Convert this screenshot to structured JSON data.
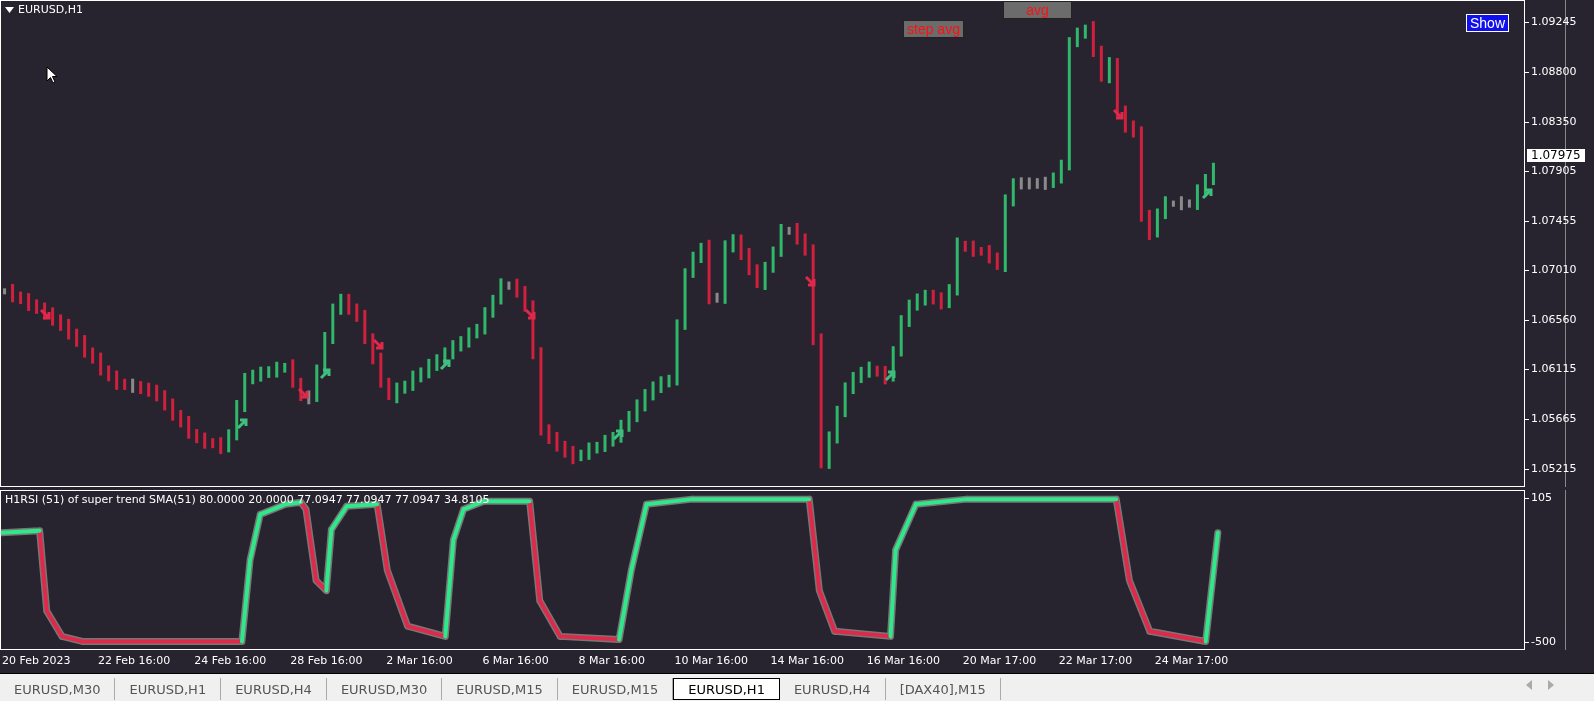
{
  "chart_title": "EURUSD,H1",
  "buttons": [
    {
      "label": "step avg",
      "kind": "step"
    },
    {
      "label": "avg",
      "kind": "avg"
    },
    {
      "label": "Show",
      "kind": "show"
    }
  ],
  "current_price": "1.07975",
  "signals": [
    {
      "kind": "down"
    },
    {
      "kind": "up"
    },
    {
      "kind": "down"
    },
    {
      "kind": "up"
    },
    {
      "kind": "down"
    },
    {
      "kind": "up"
    },
    {
      "kind": "down"
    },
    {
      "kind": "up"
    },
    {
      "kind": "down"
    },
    {
      "kind": "up"
    },
    {
      "kind": "down"
    },
    {
      "kind": "up"
    }
  ],
  "price_labels": [
    "1.09245",
    "1.08800",
    "1.08350",
    "1.07905",
    "1.07455",
    "1.07010",
    "1.06560",
    "1.06115",
    "1.05665",
    "1.05215"
  ],
  "date_labels": [
    "20 Feb 2023",
    "22 Feb 16:00",
    "24 Feb 16:00",
    "28 Feb 16:00",
    "2 Mar 16:00",
    "6 Mar 16:00",
    "8 Mar 16:00",
    "10 Mar 16:00",
    "14 Mar 16:00",
    "16 Mar 16:00",
    "20 Mar 17:00",
    "22 Mar 17:00",
    "24 Mar 17:00"
  ],
  "indicator": {
    "label": "H1RSI (51) of super trend SMA(51) 80.0000 20.0000 77.0947 77.0947 77.0947 34.8105",
    "scale_labels": [
      "105",
      "-500"
    ]
  },
  "tabs": [
    {
      "label": "EURUSD,M30",
      "selected": false
    },
    {
      "label": "EURUSD,H1",
      "selected": false
    },
    {
      "label": "EURUSD,H4",
      "selected": false
    },
    {
      "label": "EURUSD,M30",
      "selected": false
    },
    {
      "label": "EURUSD,M15",
      "selected": false
    },
    {
      "label": "EURUSD,M15",
      "selected": false
    },
    {
      "label": "EURUSD,H1",
      "selected": true
    },
    {
      "label": "EURUSD,H4",
      "selected": false
    },
    {
      "label": "[DAX40],M15",
      "selected": false
    }
  ]
}
